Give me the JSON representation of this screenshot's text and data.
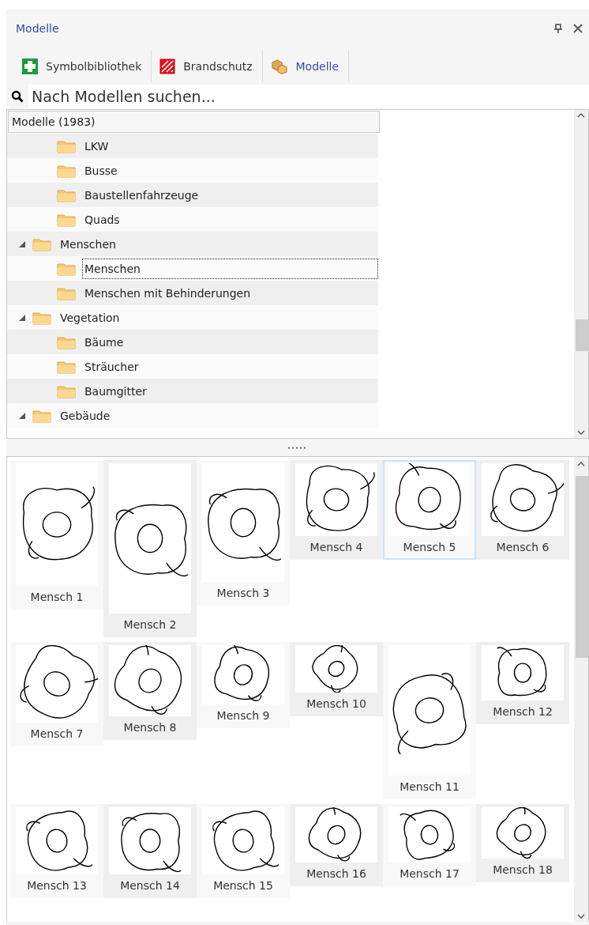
{
  "panel": {
    "title": "Modelle"
  },
  "tabs": [
    {
      "label": "Symbolbibliothek",
      "kind": "library",
      "selected": false
    },
    {
      "label": "Brandschutz",
      "kind": "fire",
      "selected": false
    },
    {
      "label": "Modelle",
      "kind": "models",
      "selected": true
    }
  ],
  "search": {
    "placeholder": "Nach Modellen suchen..."
  },
  "tree": {
    "header": "Modelle (1983)",
    "items": [
      {
        "children": [
          {
            "label": "LKW",
            "selected": false
          },
          {
            "label": "Busse",
            "selected": false
          },
          {
            "label": "Baustellenfahrzeuge",
            "selected": false
          },
          {
            "label": "Quads",
            "selected": false
          }
        ]
      },
      {
        "label": "Menschen",
        "expanded": true,
        "selected": false,
        "children": [
          {
            "label": "Menschen",
            "selected": true
          },
          {
            "label": "Menschen mit Behinderungen",
            "selected": false
          }
        ]
      },
      {
        "label": "Vegetation",
        "expanded": true,
        "selected": false,
        "children": [
          {
            "label": "Bäume",
            "selected": false
          },
          {
            "label": "Sträucher",
            "selected": false
          },
          {
            "label": "Baumgitter",
            "selected": false
          }
        ]
      },
      {
        "label": "Gebäude",
        "expanded": true,
        "selected": false
      }
    ]
  },
  "gallery": {
    "items": [
      {
        "label": "Mensch 1",
        "selected": false
      },
      {
        "label": "Mensch 2",
        "selected": false
      },
      {
        "label": "Mensch 3",
        "selected": false
      },
      {
        "label": "Mensch 4",
        "selected": false
      },
      {
        "label": "Mensch 5",
        "selected": true
      },
      {
        "label": "Mensch 6",
        "selected": false
      },
      {
        "label": "Mensch 7",
        "selected": false
      },
      {
        "label": "Mensch 8",
        "selected": false
      },
      {
        "label": "Mensch 9",
        "selected": false
      },
      {
        "label": "Mensch 10",
        "selected": false
      },
      {
        "label": "Mensch 11",
        "selected": false
      },
      {
        "label": "Mensch 12",
        "selected": false
      },
      {
        "label": "Mensch 13",
        "selected": false
      },
      {
        "label": "Mensch 14",
        "selected": false
      },
      {
        "label": "Mensch 15",
        "selected": false
      },
      {
        "label": "Mensch 16",
        "selected": false
      },
      {
        "label": "Mensch 17",
        "selected": false
      },
      {
        "label": "Mensch 18",
        "selected": false
      }
    ]
  }
}
